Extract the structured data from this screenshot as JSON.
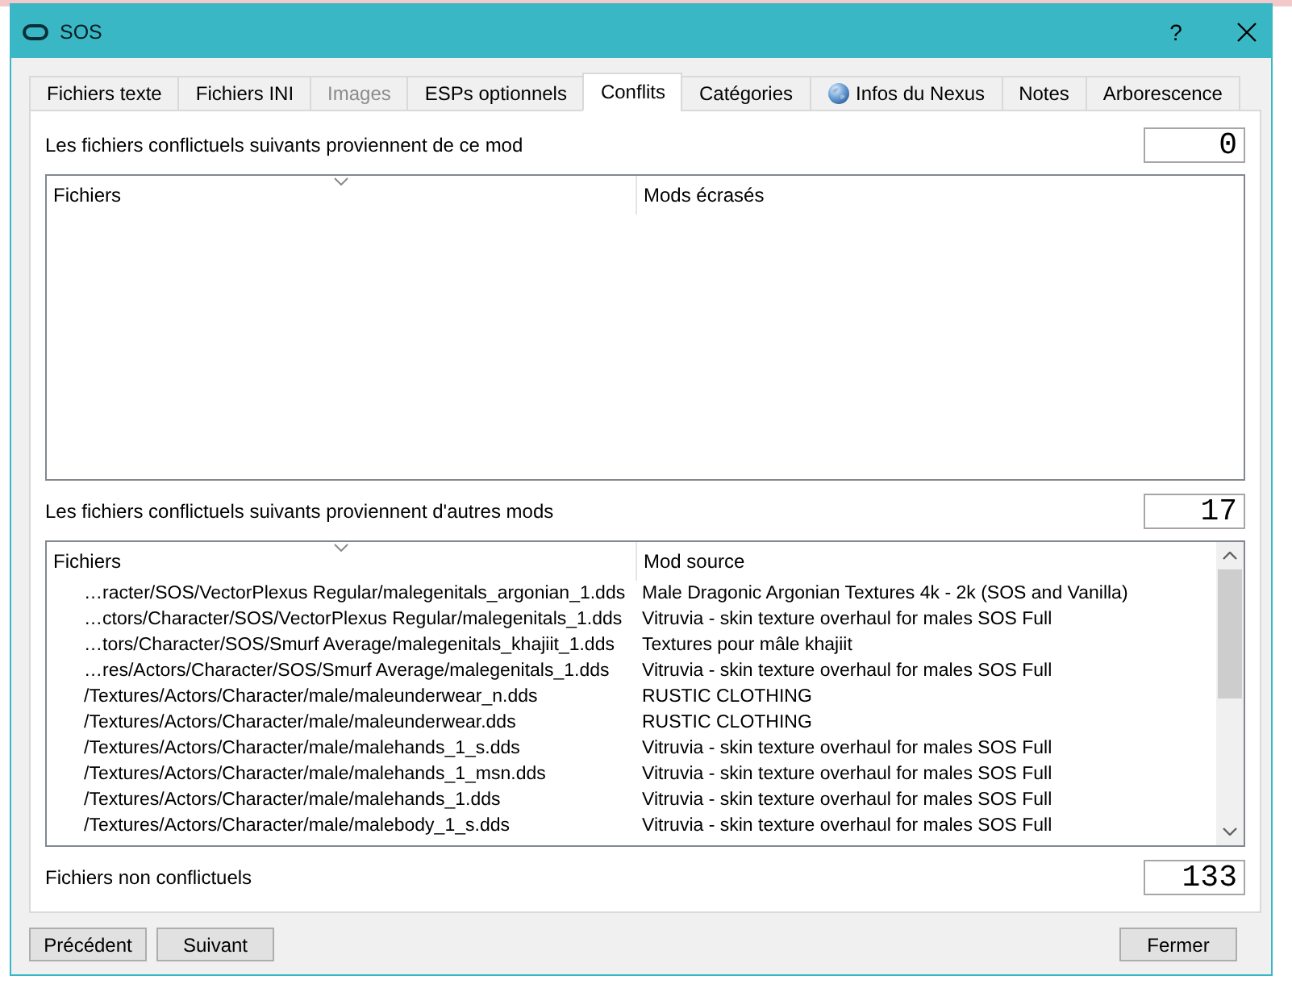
{
  "window": {
    "title": "SOS",
    "help": "?"
  },
  "tabs": [
    {
      "label": "Fichiers texte",
      "kind": "text",
      "selected": false,
      "disabled": false
    },
    {
      "label": "Fichiers INI",
      "kind": "text",
      "selected": false,
      "disabled": false
    },
    {
      "label": "Images",
      "kind": "text",
      "selected": false,
      "disabled": true
    },
    {
      "label": "ESPs optionnels",
      "kind": "text",
      "selected": false,
      "disabled": false
    },
    {
      "label": "Conflits",
      "kind": "text",
      "selected": true,
      "disabled": false
    },
    {
      "label": "Catégories",
      "kind": "text",
      "selected": false,
      "disabled": false
    },
    {
      "label": "Infos du Nexus",
      "kind": "icon_text",
      "selected": false,
      "disabled": false
    },
    {
      "label": "Notes",
      "kind": "text",
      "selected": false,
      "disabled": false
    },
    {
      "label": "Arborescence",
      "kind": "text",
      "selected": false,
      "disabled": false
    }
  ],
  "sections": [
    {
      "label": "Les fichiers conflictuels suivants proviennent de ce mod",
      "count": "0",
      "columns": [
        {
          "label": "Fichiers",
          "sorted": true
        },
        {
          "label": "Mods écrasés",
          "sorted": false
        }
      ]
    },
    {
      "label": "Les fichiers conflictuels suivants proviennent d'autres mods",
      "count": "17",
      "columns": [
        {
          "label": "Fichiers",
          "sorted": true
        },
        {
          "label": "Mod source",
          "sorted": false
        }
      ],
      "rows": [
        [
          "…racter/SOS/VectorPlexus Regular/malegenitals_argonian_1.dds",
          "Male Dragonic Argonian Textures 4k - 2k (SOS and Vanilla)"
        ],
        [
          "…ctors/Character/SOS/VectorPlexus Regular/malegenitals_1.dds",
          "Vitruvia - skin texture overhaul for males SOS Full"
        ],
        [
          "…tors/Character/SOS/Smurf Average/malegenitals_khajiit_1.dds",
          "Textures pour mâle khajiit"
        ],
        [
          "…res/Actors/Character/SOS/Smurf Average/malegenitals_1.dds",
          "Vitruvia - skin texture overhaul for males SOS Full"
        ],
        [
          "/Textures/Actors/Character/male/maleunderwear_n.dds",
          "RUSTIC CLOTHING"
        ],
        [
          "/Textures/Actors/Character/male/maleunderwear.dds",
          "RUSTIC CLOTHING"
        ],
        [
          "/Textures/Actors/Character/male/malehands_1_s.dds",
          "Vitruvia - skin texture overhaul for males SOS Full"
        ],
        [
          "/Textures/Actors/Character/male/malehands_1_msn.dds",
          "Vitruvia - skin texture overhaul for males SOS Full"
        ],
        [
          "/Textures/Actors/Character/male/malehands_1.dds",
          "Vitruvia - skin texture overhaul for males SOS Full"
        ],
        [
          "/Textures/Actors/Character/male/malebody_1_s.dds",
          "Vitruvia - skin texture overhaul for males SOS Full"
        ]
      ]
    }
  ],
  "non_conflicting": {
    "label": "Fichiers non conflictuels",
    "count": "133"
  },
  "buttons_left": [
    "Précédent",
    "Suivant"
  ],
  "buttons_right": [
    "Fermer"
  ]
}
